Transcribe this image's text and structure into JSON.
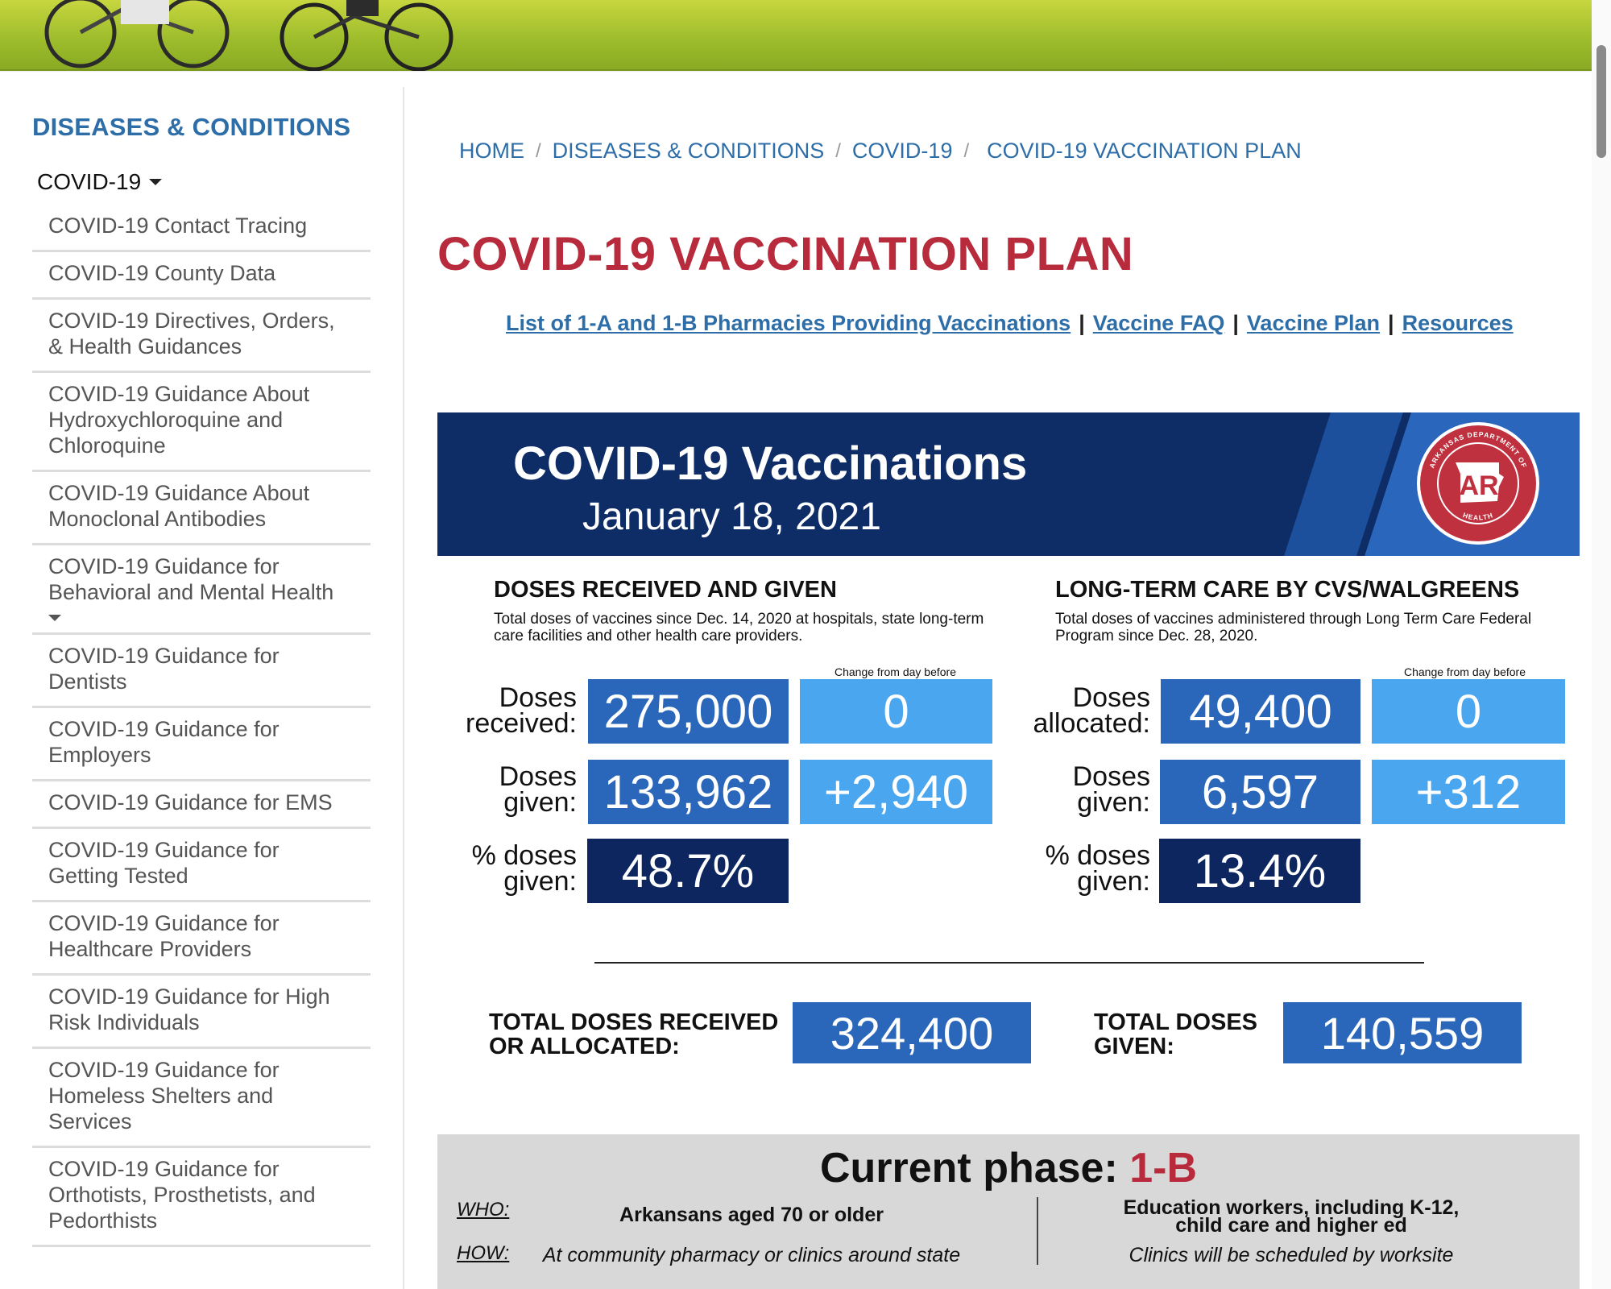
{
  "sidebar": {
    "title": "DISEASES & CONDITIONS",
    "section": "COVID-19",
    "items": [
      {
        "label": "COVID-19 Contact Tracing"
      },
      {
        "label": "COVID-19 County Data"
      },
      {
        "label": "COVID-19 Directives, Orders, & Health Guidances"
      },
      {
        "label": "COVID-19 Guidance About Hydroxychloroquine and Chloroquine"
      },
      {
        "label": "COVID-19 Guidance About Monoclonal Antibodies"
      },
      {
        "label": "COVID-19 Guidance for Behavioral and Mental Health"
      },
      {
        "label": "COVID-19 Guidance for Dentists"
      },
      {
        "label": "COVID-19 Guidance for Employers"
      },
      {
        "label": "COVID-19 Guidance for EMS"
      },
      {
        "label": "COVID-19 Guidance for Getting Tested"
      },
      {
        "label": "COVID-19 Guidance for Healthcare Providers"
      },
      {
        "label": "COVID-19 Guidance for High Risk Individuals"
      },
      {
        "label": "COVID-19 Guidance for Homeless Shelters and Services"
      },
      {
        "label": "COVID-19 Guidance for Orthotists, Prosthetists, and Pedorthists"
      }
    ]
  },
  "breadcrumb": {
    "home": "HOME",
    "diseases": "DISEASES & CONDITIONS",
    "covid": "COVID-19",
    "current": "COVID-19 VACCINATION PLAN",
    "separator": "/"
  },
  "page": {
    "title": "COVID-19 VACCINATION PLAN"
  },
  "quick_links": {
    "pharmacies": "List of 1-A and 1-B Pharmacies Providing Vaccinations",
    "faq": "Vaccine FAQ",
    "plan": "Vaccine Plan",
    "resources": "Resources",
    "separator": "|"
  },
  "infographic": {
    "title": "COVID-19 Vaccinations",
    "date": "January 18, 2021",
    "seal_text_top": "ARKANSAS DEPARTMENT OF",
    "seal_text_bottom": "HEALTH",
    "seal_letters": "AR",
    "change_label": "Change from day before",
    "left": {
      "heading": "DOSES RECEIVED AND GIVEN",
      "description": "Total doses of vaccines since Dec. 14, 2020 at hospitals, state long-term care facilities and other health care providers.",
      "row1_label_a": "Doses",
      "row1_label_b": "received:",
      "row1_value": "275,000",
      "row1_change": "0",
      "row2_label_a": "Doses",
      "row2_label_b": "given:",
      "row2_value": "133,962",
      "row2_change": "+2,940",
      "row3_label_a": "% doses",
      "row3_label_b": "given:",
      "row3_value": "48.7%"
    },
    "right": {
      "heading": "LONG-TERM CARE BY CVS/WALGREENS",
      "description": "Total doses of vaccines administered through Long Term Care Federal Program since Dec. 28, 2020.",
      "row1_label_a": "Doses",
      "row1_label_b": "allocated:",
      "row1_value": "49,400",
      "row1_change": "0",
      "row2_label_a": "Doses",
      "row2_label_b": "given:",
      "row2_value": "6,597",
      "row2_change": "+312",
      "row3_label_a": "% doses",
      "row3_label_b": "given:",
      "row3_value": "13.4%"
    },
    "totals": {
      "received_label_a": "TOTAL DOSES RECEIVED",
      "received_label_b": "OR ALLOCATED:",
      "received_value": "324,400",
      "given_label_a": "TOTAL DOSES",
      "given_label_b": "GIVEN:",
      "given_value": "140,559"
    },
    "phase": {
      "label": "Current phase:",
      "value": "1-B",
      "who_tag": "WHO:",
      "how_tag": "HOW:",
      "who_left": "Arkansans aged 70 or older",
      "who_right_a": "Education workers, including K-12,",
      "who_right_b": "child care and higher ed",
      "how_left": "At community pharmacy or clinics around state",
      "how_right": "Clinics will be scheduled by worksite"
    },
    "colors": {
      "navy": "#0e2c66",
      "mid_blue": "#2a67bb",
      "light_blue": "#4ba6f0",
      "dark_blue": "#0d2660",
      "red": "#b72b3c"
    }
  }
}
